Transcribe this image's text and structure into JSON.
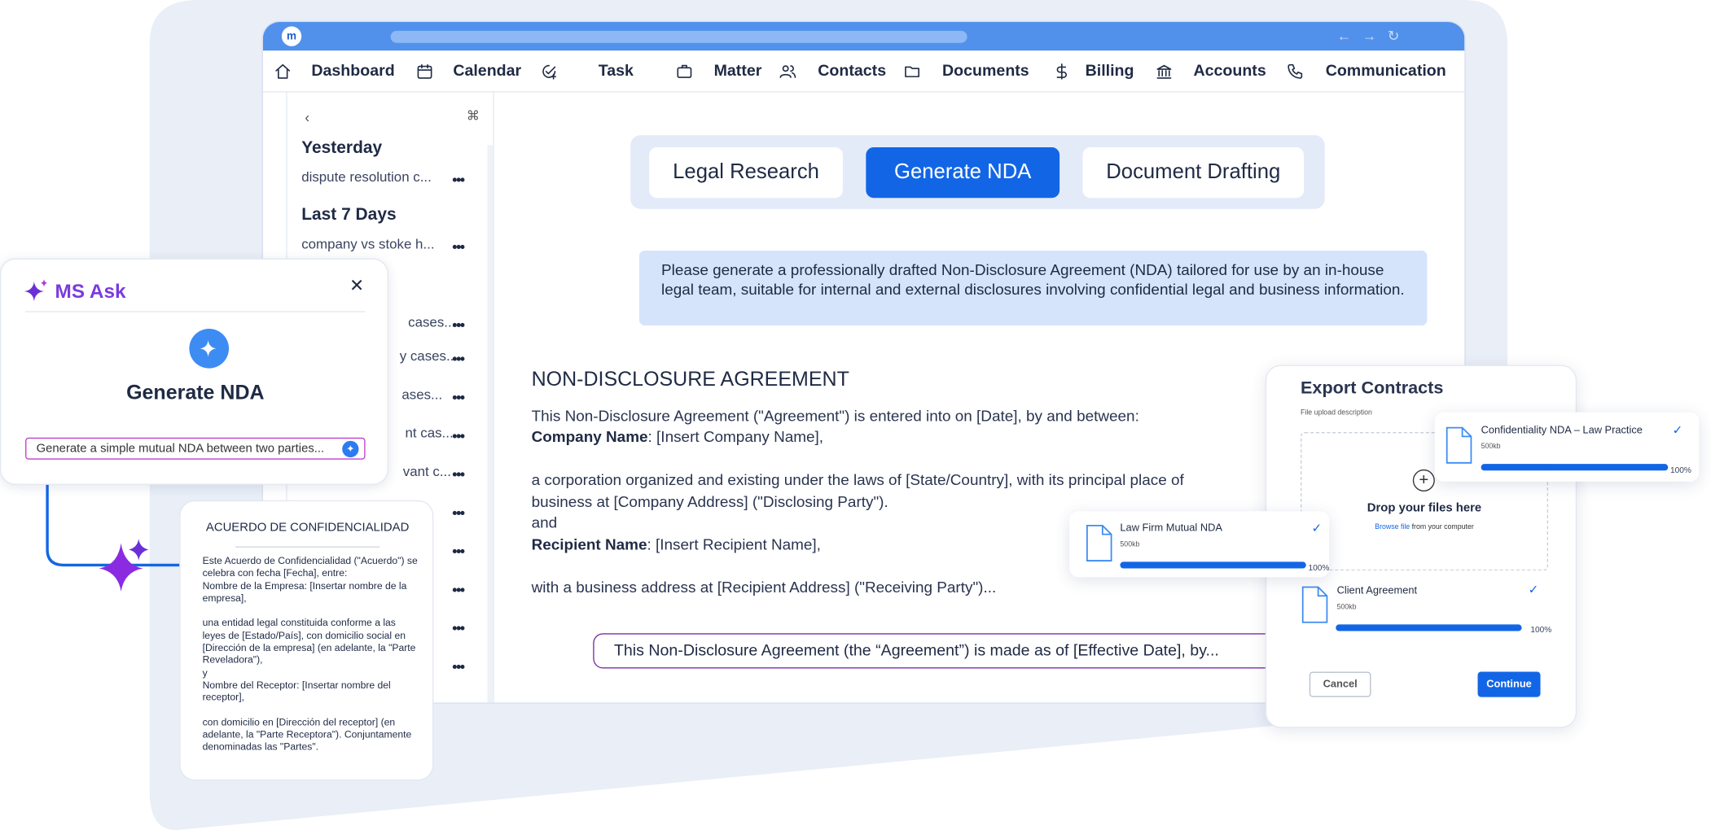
{
  "app": {
    "logo_text": "m",
    "nav": [
      {
        "label": "Dashboard",
        "icon": "home-icon"
      },
      {
        "label": "Calendar",
        "icon": "calendar-icon"
      },
      {
        "label": "Task",
        "icon": "task-check-icon"
      },
      {
        "label": "Matter",
        "icon": "briefcase-icon"
      },
      {
        "label": "Contacts",
        "icon": "people-icon"
      },
      {
        "label": "Documents",
        "icon": "folder-icon"
      },
      {
        "label": "Billing",
        "icon": "dollar-icon"
      },
      {
        "label": "Accounts",
        "icon": "bank-icon"
      },
      {
        "label": "Communication",
        "icon": "phone-icon"
      }
    ]
  },
  "sidebar": {
    "groups": [
      {
        "label": "Yesterday",
        "items": [
          "dispute resolution c..."
        ]
      },
      {
        "label": "Last 7 Days",
        "items": [
          "company vs stoke h..."
        ]
      }
    ],
    "hidden_items": [
      "cases...",
      "y cases...",
      "ases...",
      "nt cas...",
      "vant c..."
    ],
    "more_label": "•••"
  },
  "tabs": {
    "items": [
      "Legal Research",
      "Generate NDA",
      "Document Drafting"
    ],
    "active": "Generate NDA"
  },
  "prompt": "Please generate a professionally drafted Non-Disclosure Agreement (NDA) tailored for use by an in-house legal team, suitable for internal and external disclosures involving confidential legal and business information.",
  "document": {
    "title": "NON-DISCLOSURE AGREEMENT",
    "intro": "This Non-Disclosure Agreement (\"Agreement\") is entered into on [Date], by and between:",
    "company_label": "Company Name",
    "company_value": ": [Insert Company Name],",
    "corp_text": "a corporation organized and existing under the laws of [State/Country], with its principal place of business at [Company Address] (\"Disclosing Party\").",
    "and": "and",
    "recipient_label": "Recipient Name",
    "recipient_value": ": [Insert Recipient Name],",
    "address_text": "with a business address at [Recipient Address] (\"Receiving Party\")..."
  },
  "suggestion": "This Non-Disclosure Agreement (the “Agreement”) is made as of [Effective Date], by...",
  "ms_ask": {
    "brand": "MS Ask",
    "title": "Generate NDA",
    "input_value": "Generate a simple mutual NDA between two parties...",
    "brand_colors": [
      "#6b2fd6",
      "#2b7cf0"
    ]
  },
  "spanish_doc": {
    "title": "ACUERDO DE CONFIDENCIALIDAD",
    "p1": "Este Acuerdo de Confidencialidad (\"Acuerdo\") se celebra con fecha [Fecha], entre:",
    "p2": "Nombre de la Empresa: [Insertar nombre de la empresa],",
    "p3": "una entidad legal constituida conforme a las leyes de [Estado/País], con domicilio social en [Dirección de la empresa] (en adelante, la \"Parte Reveladora\"),",
    "p4": "y",
    "p5": "Nombre del Receptor: [Insertar nombre del receptor],",
    "p6": "con domicilio en [Dirección del receptor] (en adelante, la \"Parte Receptora\"). Conjuntamente denominadas las \"Partes\"."
  },
  "export": {
    "title": "Export Contracts",
    "subtitle": "File upload description",
    "drop_text": "Drop your files here",
    "browse_link": "Browse file",
    "browse_rest": " from your computer",
    "cancel": "Cancel",
    "continue": "Continue",
    "files": [
      {
        "name": "Confidentiality NDA – Law Practice",
        "size": "500kb",
        "progress": "100%"
      },
      {
        "name": "Law Firm Mutual NDA",
        "size": "500kb",
        "progress": "100%"
      },
      {
        "name": "Client Agreement",
        "size": "500kb",
        "progress": "100%"
      }
    ]
  },
  "colors": {
    "accent": "#1266e6",
    "titlebar": "#5191ec",
    "prompt_bg": "#d5e3fb",
    "backdrop": "#e9eef7"
  }
}
